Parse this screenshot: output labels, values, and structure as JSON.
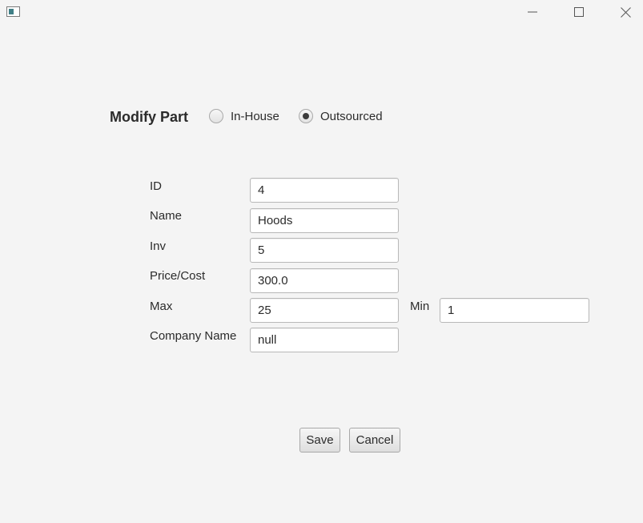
{
  "window": {
    "icon": "app-window-icon",
    "controls": {
      "minimize_icon": "minimize-icon",
      "maximize_icon": "maximize-icon",
      "close_icon": "close-icon"
    }
  },
  "header": {
    "title": "Modify Part",
    "source_options": [
      {
        "label": "In-House",
        "selected": false
      },
      {
        "label": "Outsourced",
        "selected": true
      }
    ]
  },
  "form": {
    "fields": [
      {
        "key": "id",
        "label": "ID",
        "value": "4"
      },
      {
        "key": "name",
        "label": "Name",
        "value": "Hoods"
      },
      {
        "key": "inv",
        "label": "Inv",
        "value": "5"
      },
      {
        "key": "price",
        "label": "Price/Cost",
        "value": "300.0"
      },
      {
        "key": "max",
        "label": "Max",
        "value": "25"
      },
      {
        "key": "company",
        "label": "Company Name",
        "value": "null"
      }
    ],
    "min": {
      "label": "Min",
      "value": "1"
    }
  },
  "actions": {
    "save_label": "Save",
    "cancel_label": "Cancel"
  },
  "colors": {
    "background": "#f4f4f4",
    "text": "#2b2b2b",
    "input_border": "#b8b8b8"
  }
}
